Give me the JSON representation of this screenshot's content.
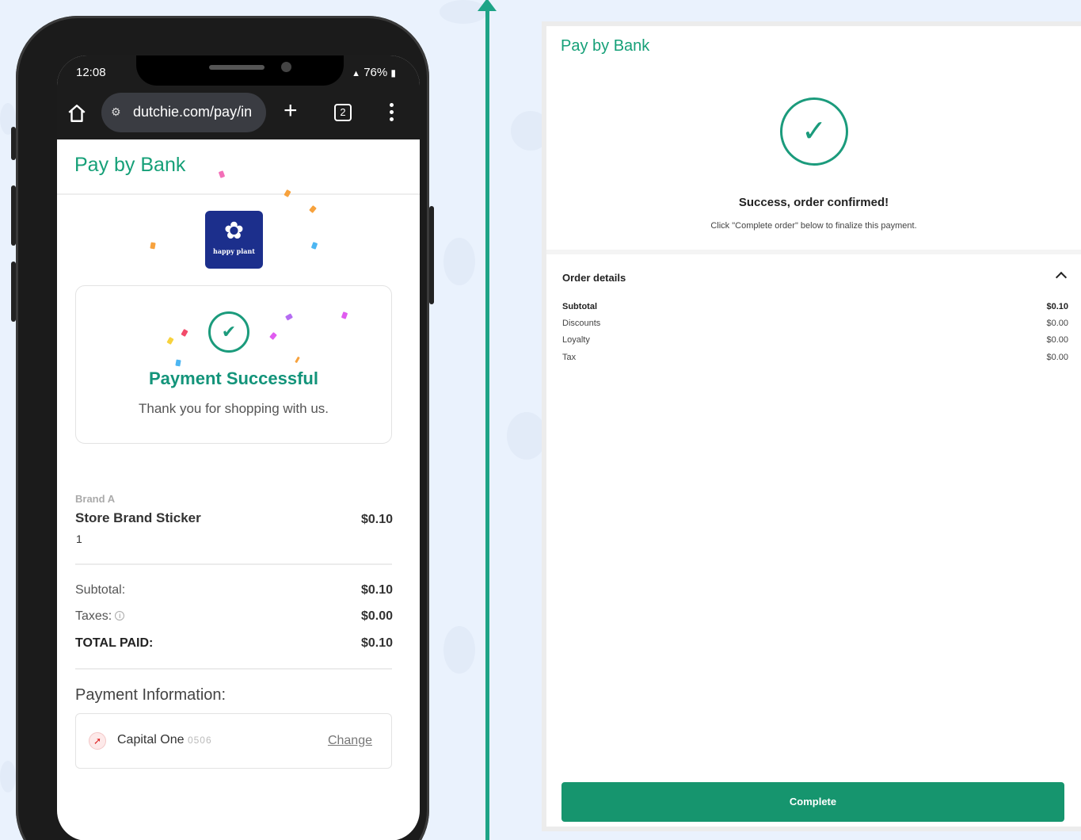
{
  "phone": {
    "status_time": "12:08",
    "status_battery": "76%",
    "url": "dutchie.com/pay/in",
    "tab_count": "2",
    "header_title": "Pay by Bank",
    "store_logo_text": "happy plant",
    "success_title": "Payment Successful",
    "success_subtitle": "Thank you for shopping with us.",
    "product": {
      "brand": "Brand A",
      "name": "Store Brand Sticker",
      "price": "$0.10",
      "quantity": "1"
    },
    "totals": {
      "subtotal_label": "Subtotal:",
      "subtotal_value": "$0.10",
      "taxes_label": "Taxes:",
      "taxes_value": "$0.00",
      "total_label": "TOTAL PAID:",
      "total_value": "$0.10"
    },
    "payment_info_title": "Payment Information:",
    "bank_name": "Capital One",
    "bank_mask": "0506",
    "change_label": "Change"
  },
  "panel": {
    "title": "Pay by Bank",
    "success_message": "Success, order confirmed!",
    "instruction": "Click \"Complete order\" below to finalize this payment.",
    "order_details_title": "Order details",
    "order_rows": [
      {
        "label": "Subtotal",
        "value": "$0.10"
      },
      {
        "label": "Discounts",
        "value": "$0.00"
      },
      {
        "label": "Loyalty",
        "value": "$0.00"
      },
      {
        "label": "Tax",
        "value": "$0.00"
      }
    ],
    "complete_label": "Complete"
  },
  "colors": {
    "brand_green": "#16a078",
    "button_green": "#16956e",
    "arrow_teal": "#1ea487",
    "background": "#eaf2fd",
    "logo_navy": "#1c2f8c"
  },
  "icons": [
    "home-icon",
    "site-settings-icon",
    "new-tab-plus-icon",
    "tab-switcher-icon",
    "overflow-menu-icon",
    "check-circle-icon",
    "info-icon",
    "bank-logo-icon",
    "chevron-up-icon",
    "arrow-up-icon"
  ]
}
